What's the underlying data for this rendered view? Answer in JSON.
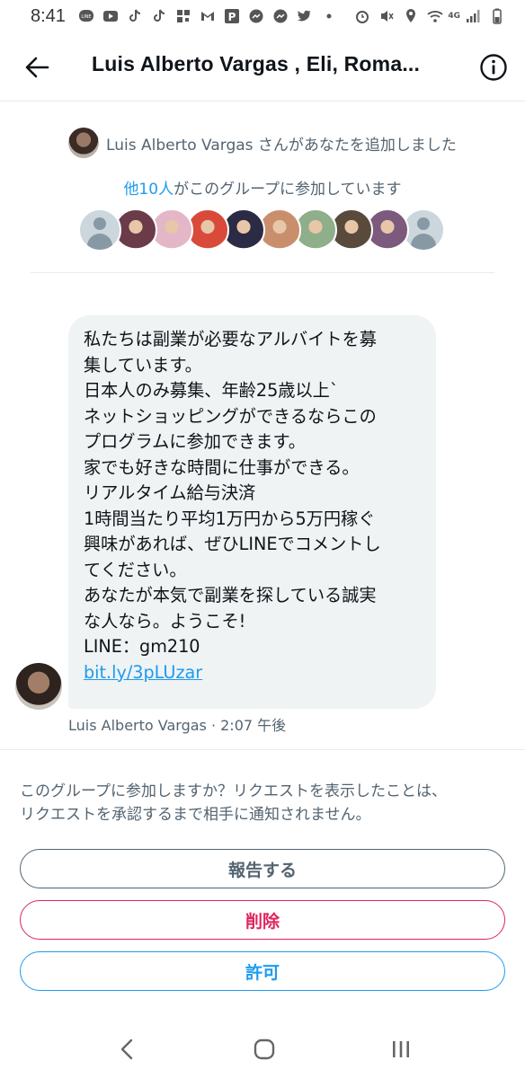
{
  "status_bar": {
    "time": "8:41",
    "network": "4G",
    "icons_left": [
      "line-icon",
      "youtube-icon",
      "tiktok-icon",
      "tiktok-icon",
      "qr-icon",
      "gmail-icon",
      "parking-icon",
      "messenger-icon",
      "messenger-icon",
      "twitter-icon",
      "dot-icon"
    ],
    "icons_right": [
      "alarm-icon",
      "mute-icon",
      "location-icon",
      "wifi-icon",
      "signal-icon",
      "battery-icon"
    ]
  },
  "header": {
    "title": "Luis Alberto Vargas , Eli, Roma..."
  },
  "group_info": {
    "added_text": "Luis Alberto Vargas さんがあなたを追加しました",
    "others_link": "他10人",
    "others_text": "がこのグループに参加しています",
    "member_avatars": [
      {
        "kind": "default",
        "color": "#ccd6dd"
      },
      {
        "kind": "photo",
        "color": "#6b3b4a"
      },
      {
        "kind": "photo",
        "color": "#e3b7c8"
      },
      {
        "kind": "photo",
        "color": "#d94a3a"
      },
      {
        "kind": "photo",
        "color": "#2b2b45"
      },
      {
        "kind": "photo",
        "color": "#c98f6c"
      },
      {
        "kind": "photo",
        "color": "#8fae8a"
      },
      {
        "kind": "photo",
        "color": "#5a4a3c"
      },
      {
        "kind": "photo",
        "color": "#7b5a7d"
      },
      {
        "kind": "default",
        "color": "#ccd6dd"
      }
    ]
  },
  "message": {
    "lines": [
      "私たちは副業が必要なアルバイトを募",
      "集しています。",
      "日本人のみ募集、年齢25歳以上`",
      "ネットショッピングができるならこの",
      "プログラムに参加できます。",
      "家でも好きな時間に仕事ができる。",
      "リアルタイム給与決済",
      "1時間当たり平均1万円から5万円稼ぐ",
      "興味があれば、ぜひLINEでコメントし",
      "てください。",
      "あなたが本気で副業を探している誠実",
      "な人なら。ようこそ!",
      "LINE：gm210"
    ],
    "link": "bit.ly/3pLUzar",
    "sender": "Luis Alberto Vargas",
    "time": " · 2:07 午後"
  },
  "request": {
    "text_line1": "このグループに参加しますか？リクエストを表示したことは、",
    "text_line2": "リクエストを承認するまで相手に通知されません。",
    "report_label": "報告する",
    "delete_label": "削除",
    "accept_label": "許可"
  },
  "colors": {
    "accent": "#1d9bf0",
    "danger": "#e0245e",
    "muted": "#536471",
    "bubble": "#eff3f4"
  }
}
